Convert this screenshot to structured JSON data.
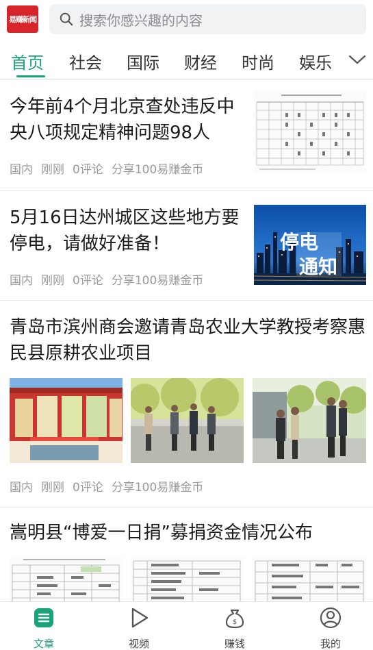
{
  "header": {
    "logo_text": "易赚新闻",
    "search_placeholder": "搜索你感兴趣的内容"
  },
  "tabs": [
    "首页",
    "社会",
    "国际",
    "财经",
    "时尚",
    "娱乐"
  ],
  "colors": {
    "accent": "#18a37a",
    "brand_red": "#d7262b",
    "text": "#1a1a1a",
    "meta": "#9a9a9a"
  },
  "articles": [
    {
      "title": "今年前4个月北京查处违反中央八项规定精神问题98人",
      "meta": {
        "category": "国内",
        "time": "刚刚",
        "comments": "0评论",
        "share": "分享100易赚金币"
      },
      "thumb": "table-doc"
    },
    {
      "title": "5月16日达州城区这些地方要停电，请做好准备！",
      "meta": {
        "category": "国内",
        "time": "刚刚",
        "comments": "0评论",
        "share": "分享100易赚金币"
      },
      "thumb": "power-outage-notice",
      "thumb_text": [
        "停电",
        "通知"
      ]
    },
    {
      "title": "青岛市滨州商会邀请青岛农业大学教授考察惠民县原耕农业项目",
      "meta": {
        "category": "国内",
        "time": "刚刚",
        "comments": "0评论",
        "share": "分享100易赚金币"
      },
      "thumbs": [
        "building-photo",
        "group-walking-photo",
        "group-standing-photo"
      ]
    },
    {
      "title": "嵩明县“博爱一日捐”募捐资金情况公布",
      "thumbs": [
        "table-doc",
        "table-doc",
        "table-doc"
      ]
    }
  ],
  "bottom_nav": [
    {
      "label": "文章",
      "icon": "article-icon",
      "active": true
    },
    {
      "label": "视频",
      "icon": "play-icon",
      "active": false
    },
    {
      "label": "赚钱",
      "icon": "money-bag-icon",
      "active": false
    },
    {
      "label": "我的",
      "icon": "profile-icon",
      "active": false
    }
  ]
}
